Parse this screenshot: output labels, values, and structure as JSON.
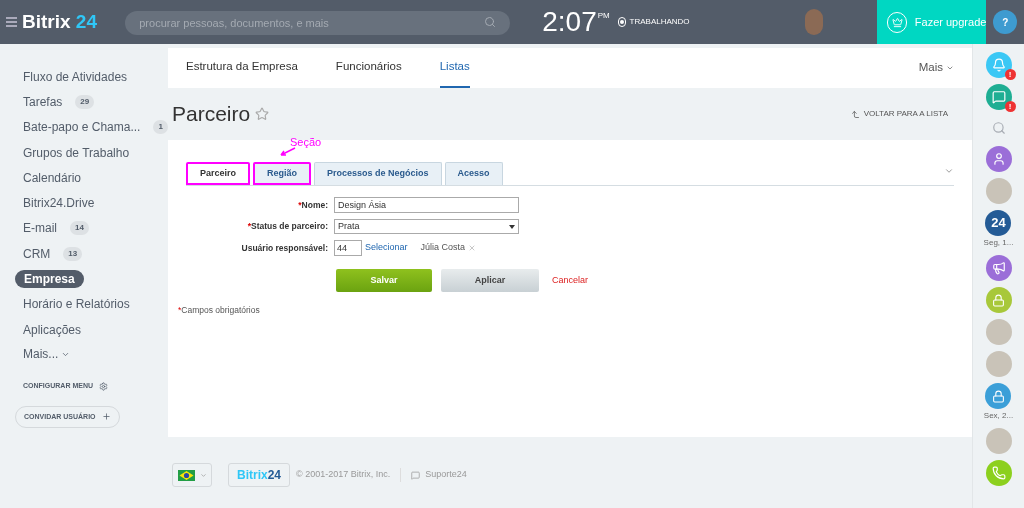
{
  "header": {
    "logo_text": "Bitrix",
    "logo_number": "24",
    "search": {
      "placeholder": "procurar pessoas, documentos, e mais"
    },
    "time": "2:07",
    "time_suffix": "PM",
    "work_status": "TRABALHANDO",
    "upgrade_button": "Fazer upgrade",
    "help_button": "?"
  },
  "sidebar": {
    "items": [
      {
        "label": "Fluxo de Atividades",
        "selected": false
      },
      {
        "label": "Tarefas",
        "count": "29",
        "selected": false
      },
      {
        "label": "Bate-papo e Chama...",
        "count": "1",
        "selected": false
      },
      {
        "label": "Grupos de Trabalho",
        "selected": false
      },
      {
        "label": "Calendário",
        "selected": false
      },
      {
        "label": "Bitrix24.Drive",
        "selected": false
      },
      {
        "label": "E-mail",
        "count": "14",
        "selected": false
      },
      {
        "label": "CRM",
        "count": "13",
        "selected": false
      },
      {
        "label": "Empresa",
        "selected": true
      },
      {
        "label": "Horário e Relatórios",
        "selected": false
      },
      {
        "label": "Aplicações",
        "selected": false
      }
    ],
    "more": "Mais...",
    "configure": "CONFIGURAR MENU",
    "invite": "CONVIDAR USUÁRIO"
  },
  "top_tabs": [
    {
      "label": "Estrutura da Empresa",
      "selected": false
    },
    {
      "label": "Funcionários",
      "selected": false
    },
    {
      "label": "Listas",
      "selected": true
    }
  ],
  "top_more": "Mais",
  "page": {
    "title": "Parceiro",
    "back_link": "VOLTAR PARA A LISTA"
  },
  "annotation": {
    "text": "Seção"
  },
  "form_tabs": [
    {
      "label": "Parceiro",
      "selected": true,
      "highlighted": true
    },
    {
      "label": "Região",
      "selected": false,
      "highlighted": true
    },
    {
      "label": "Processos de Negócios",
      "selected": false,
      "highlighted": false
    },
    {
      "label": "Acesso",
      "selected": false,
      "highlighted": false
    }
  ],
  "fields": [
    {
      "kind": "text",
      "label": "Nome:",
      "required": true,
      "value": "Design Ásia"
    },
    {
      "kind": "select",
      "label": "Status de parceiro:",
      "required": true,
      "value": "Prata"
    },
    {
      "kind": "user",
      "label": "Usuário responsável:",
      "required": false,
      "value": "44",
      "link": "Selecionar",
      "user": "Júlia Costa"
    }
  ],
  "buttons": {
    "save": "Salvar",
    "apply": "Aplicar",
    "cancel": "Cancelar"
  },
  "required_marker": "*",
  "required_note": "Campos obrigatórios",
  "footer": {
    "logo_text": "Bitrix",
    "logo_number": "24",
    "copyright": "© 2001-2017 Bitrix, Inc.",
    "support": "Suporte24"
  },
  "right_bar": [
    {
      "kind": "bell",
      "color": "#3bc8f5",
      "badge": "!"
    },
    {
      "kind": "chat",
      "color": "#1eae93",
      "badge": "!"
    },
    {
      "kind": "search"
    },
    {
      "kind": "user",
      "color": "#9b6ed8"
    },
    {
      "kind": "photo"
    },
    {
      "kind": "text",
      "color": "#245b96",
      "text": "24",
      "caption": "Seg, 1..."
    },
    {
      "kind": "megaphone",
      "color": "#9b6ed8"
    },
    {
      "kind": "lock",
      "color": "#a8c83a"
    },
    {
      "kind": "photo"
    },
    {
      "kind": "photo"
    },
    {
      "kind": "lock",
      "color": "#3b9fd8",
      "caption": "Sex, 2..."
    },
    {
      "kind": "photo"
    },
    {
      "kind": "phone",
      "color": "#8cd01e"
    }
  ]
}
